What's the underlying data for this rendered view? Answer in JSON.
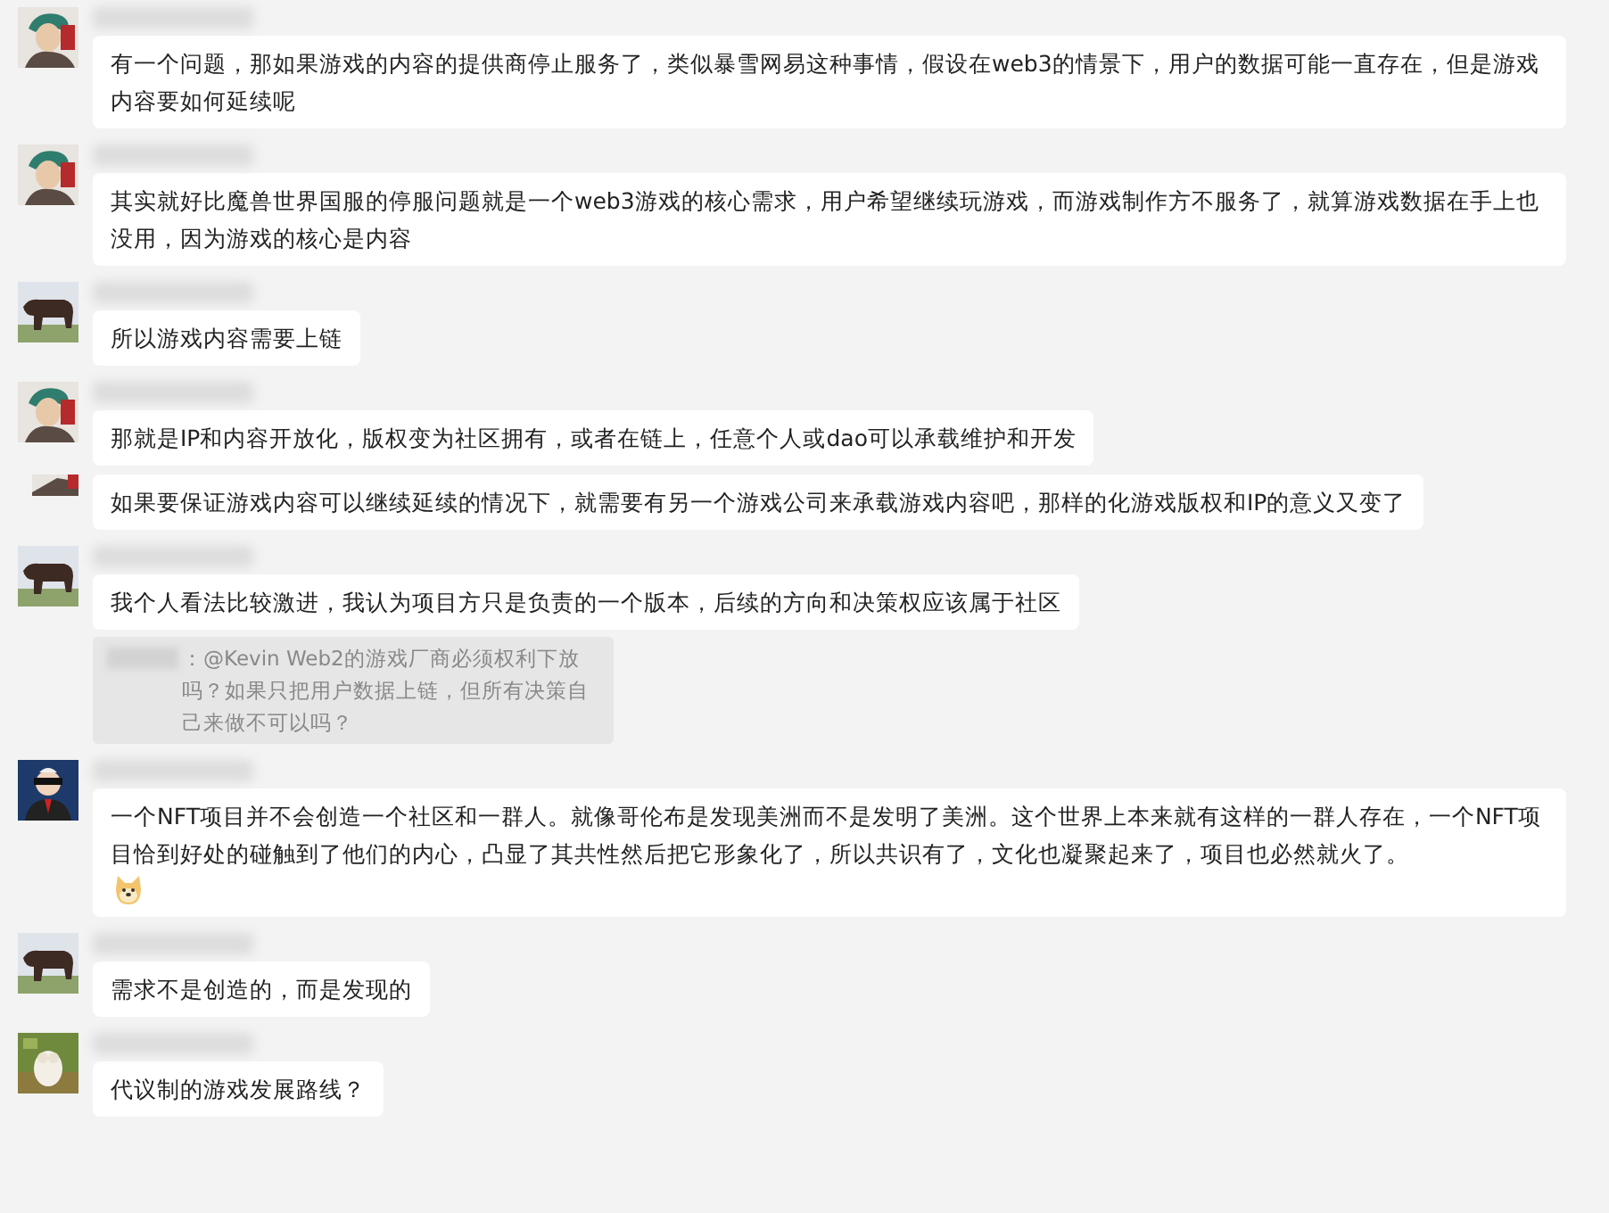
{
  "messages": [
    {
      "avatar": {
        "kind": "character"
      },
      "name_hidden": true,
      "text": "有一个问题，那如果游戏的内容的提供商停止服务了，类似暴雪网易这种事情，假设在web3的情景下，用户的数据可能一直存在，但是游戏内容要如何延续呢"
    },
    {
      "avatar": {
        "kind": "character"
      },
      "name_hidden": true,
      "text": "其实就好比魔兽世界国服的停服问题就是一个web3游戏的核心需求，用户希望继续玩游戏，而游戏制作方不服务了，就算游戏数据在手上也没用，因为游戏的核心是内容"
    },
    {
      "avatar": {
        "kind": "animal"
      },
      "name_hidden": true,
      "text": "所以游戏内容需要上链"
    },
    {
      "avatar": {
        "kind": "character"
      },
      "name_hidden": true,
      "text": "那就是IP和内容开放化，版权变为社区拥有，或者在链上，任意个人或dao可以承载维护和开发"
    },
    {
      "avatar": {
        "kind": "sliver"
      },
      "name_hidden": false,
      "text": "如果要保证游戏内容可以继续延续的情况下，就需要有另一个游戏公司来承载游戏内容吧，那样的化游戏版权和IP的意义又变了"
    },
    {
      "avatar": {
        "kind": "animal"
      },
      "name_hidden": true,
      "text": "我个人看法比较激进，我认为项目方只是负责的一个版本，后续的方向和决策权应该属于社区",
      "quote": "：@Kevin Web2的游戏厂商必须权利下放吗？如果只把用户数据上链，但所有决策自己来做不可以吗？"
    },
    {
      "avatar": {
        "kind": "suit"
      },
      "name_hidden": true,
      "text": "一个NFT项目并不会创造一个社区和一群人。就像哥伦布是发现美洲而不是发明了美洲。这个世界上本来就有这样的一群人存在，一个NFT项目恰到好处的碰触到了他们的内心，凸显了其共性然后把它形象化了，所以共识有了，文化也凝聚起来了，项目也必然就火了。",
      "sticker": true
    },
    {
      "avatar": {
        "kind": "animal"
      },
      "name_hidden": true,
      "text": "需求不是创造的，而是发现的"
    },
    {
      "name_hidden": true,
      "text": "代议制的游戏发展路线？"
    }
  ]
}
